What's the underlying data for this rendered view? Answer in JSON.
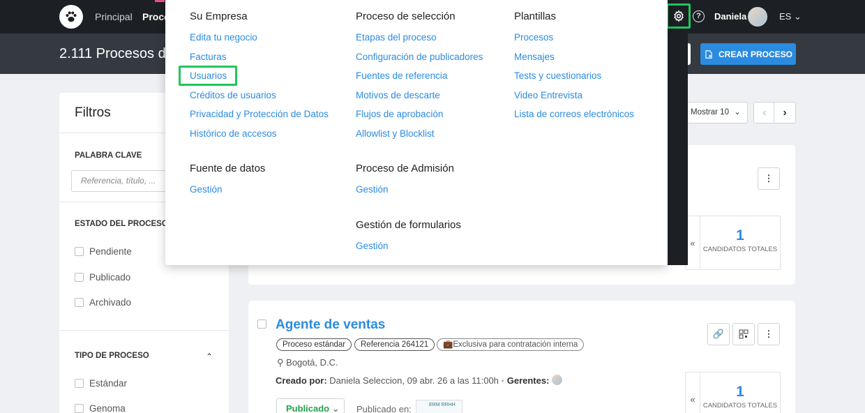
{
  "nav": {
    "items": [
      "Principal",
      "Proce"
    ],
    "user_name": "Daniela",
    "lang": "ES"
  },
  "header": {
    "title": "2.111 Procesos de",
    "create_label": "CREAR PROCESO"
  },
  "filters": {
    "title": "Filtros",
    "keyword_label": "PALABRA CLAVE",
    "keyword_placeholder": "Referencia, título, ...",
    "status_label": "ESTADO DEL PROCESO",
    "status_options": [
      "Pendiente",
      "Publicado",
      "Archivado"
    ],
    "type_label": "TIPO DE PROCESO",
    "type_options": [
      "Estándar",
      "Genoma"
    ]
  },
  "list": {
    "show_label": "Mostrar 10",
    "cards": [
      {
        "candidates": "1",
        "candidates_label": "CANDIDATOS TOTALES"
      },
      {
        "title": "Agente de ventas",
        "chips": [
          "Proceso estándar",
          "Referencia 264121",
          "Exclusiva para contratación interna"
        ],
        "location": "Bogotá, D.C.",
        "created_by_label": "Creado por:",
        "created_by": "Daniela Seleccion,",
        "created_at": "09 abr. 26 a las 11:00h",
        "managers_label": "Gerentes:",
        "status": "Publicado",
        "published_in_label": "Publicado en:",
        "published_logo": "ERM RRHH",
        "candidates": "1",
        "candidates_label": "CANDIDATOS TOTALES"
      }
    ]
  },
  "menu": {
    "sections": [
      {
        "title": "Su Empresa",
        "links": [
          "Edita tu negocio",
          "Facturas",
          "Usuarios",
          "Créditos de usuarios",
          "Privacidad y Protección de Datos",
          "Histórico de accesos"
        ]
      },
      {
        "title": "Proceso de selección",
        "links": [
          "Etapas del proceso",
          "Configuración de publicadores",
          "Fuentes de referencia",
          "Motivos de descarte",
          "Flujos de aprobación",
          "Allowlist y Blocklist"
        ]
      },
      {
        "title": "Plantillas",
        "links": [
          "Procesos",
          "Mensajes",
          "Tests y cuestionarios",
          "Video Entrevista",
          "Lista de correos electrónicos"
        ]
      },
      {
        "title": "Fuente de datos",
        "links": [
          "Gestión"
        ]
      },
      {
        "title": "Proceso de Admisión",
        "links": [
          "Gestión"
        ]
      },
      {
        "title": "Gestión de formularios",
        "links": [
          "Gestión"
        ]
      }
    ]
  },
  "colors": {
    "accent": "#2b8be0",
    "highlight": "#22c55e",
    "topbar": "#1c1f23"
  }
}
